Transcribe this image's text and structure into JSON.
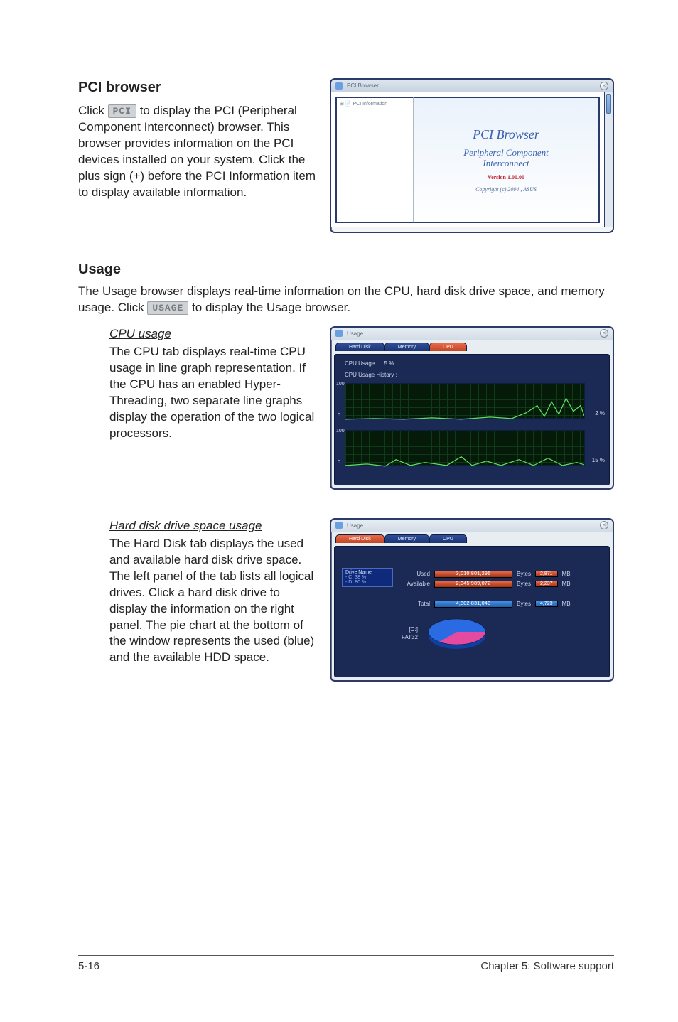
{
  "pci_section": {
    "heading": "PCI browser",
    "paragraph_pre": "Click ",
    "button_label": "PCI",
    "paragraph_post": " to display the PCI (Peripheral Component Interconnect) browser. This browser provides information on the PCI devices installed on your system. Click the plus sign (+) before the PCI Information item to display available information."
  },
  "pci_window": {
    "title": "PCI Browser",
    "tree_root": "PCI Information",
    "main_title": "PCI Browser",
    "main_sub1": "Peripheral Component",
    "main_sub2": "Interconnect",
    "version": "Version 1.00.00",
    "copyright": "Copyright (c) 2004 , ASUS"
  },
  "usage_section": {
    "heading": "Usage",
    "paragraph_pre": "The Usage browser displays real-time information on the CPU, hard disk drive space, and memory usage. Click ",
    "button_label": "USAGE",
    "paragraph_post": " to display the Usage browser."
  },
  "cpu_block": {
    "subheading": "CPU usage",
    "paragraph": "The CPU tab displays real-time CPU usage in line graph representation. If the CPU has an enabled Hyper-Threading, two separate line graphs display the operation of the two logical processors."
  },
  "cpu_window": {
    "title": "Usage",
    "tab_harddisk": "Hard Disk",
    "tab_memory": "Memory",
    "tab_cpu": "CPU",
    "label_usage": "CPU Usage :",
    "label_usage_val": "5  %",
    "label_history": "CPU Usage History :",
    "y100_1": "100",
    "y0_1": "0",
    "y100_2": "100",
    "y0_2": "0",
    "pct1": "2 %",
    "pct2": "15 %"
  },
  "hdd_block": {
    "subheading": "Hard disk drive space usage",
    "paragraph": "The Hard Disk tab displays the used and available hard disk drive space. The left panel of the tab lists all logical drives. Click a hard disk drive to display the information on the right panel. The pie chart at the bottom of the window represents the used (blue) and the available HDD space."
  },
  "hdd_window": {
    "title": "Usage",
    "tab_harddisk": "Hard Disk",
    "tab_memory": "Memory",
    "tab_cpu": "CPU",
    "drive_header": "Drive Name",
    "drive_c": "- C: 38 %",
    "drive_d": "- D: 80 %",
    "row_used_label": "Used",
    "row_used_bar": "3,010,801,296",
    "row_used_unit": "Bytes",
    "row_used_tag": "2,871",
    "row_used_tag_unit": "MB",
    "row_avail_label": "Available",
    "row_avail_bar": "2,345,989,072",
    "row_avail_unit": "Bytes",
    "row_avail_tag": "2,237",
    "row_avail_tag_unit": "MB",
    "row_total_label": "Total",
    "row_total_bar": "4,302,831,040",
    "row_total_unit": "Bytes",
    "row_total_tag": "4,723",
    "row_total_tag_unit": "MB",
    "pie_label1": "[C:]",
    "pie_label2": "FAT32"
  },
  "footer": {
    "page_num": "5-16",
    "chapter": "Chapter 5: Software support"
  }
}
